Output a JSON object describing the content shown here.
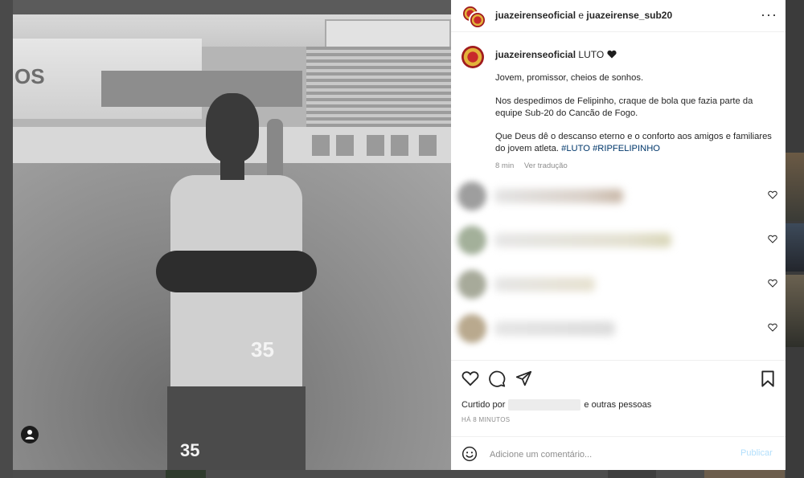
{
  "header": {
    "account_primary": "juazeirenseoficial",
    "connector": "e",
    "account_secondary": "juazeirense_sub20",
    "more_icon": "more-horizontal-icon"
  },
  "caption": {
    "username": "juazeirenseoficial",
    "title": "LUTO",
    "title_emoji": "black-heart-icon",
    "paragraph_1": "Jovem, promissor, cheios de sonhos.",
    "paragraph_2": "Nos despedimos de Felipinho, craque de bola que fazia parte da equipe Sub-20 do Cancão de Fogo.",
    "paragraph_3_text": "Que Deus dê o descanso eterno e o conforto aos amigos e familiares do jovem atleta.",
    "hashtag_1": "#LUTO",
    "hashtag_2": "#RIPFELIPINHO",
    "time_ago": "8 min",
    "translate_link": "Ver tradução"
  },
  "comments": [
    {
      "blurred": true,
      "like_icon": "heart-outline-icon"
    },
    {
      "blurred": true,
      "like_icon": "heart-outline-icon"
    },
    {
      "blurred": true,
      "like_icon": "heart-outline-icon"
    },
    {
      "blurred": true,
      "like_icon": "heart-outline-icon"
    }
  ],
  "photo": {
    "jersey_number": "35",
    "board_text": "OS"
  },
  "actions": {
    "like_icon": "heart-outline-icon",
    "comment_icon": "comment-bubble-icon",
    "share_icon": "paper-plane-icon",
    "save_icon": "bookmark-icon"
  },
  "likes": {
    "prefix": "Curtido por",
    "suffix": "e outras pessoas"
  },
  "timestamp": "HÁ 8 MINUTOS",
  "add_comment": {
    "placeholder": "Adicione um comentário...",
    "publish_label": "Publicar",
    "emoji_icon": "smiley-icon"
  },
  "colors": {
    "link": "#00376b",
    "publish_disabled": "#b2dffc",
    "muted_text": "#8e8e8e",
    "primary_text": "#262626"
  }
}
